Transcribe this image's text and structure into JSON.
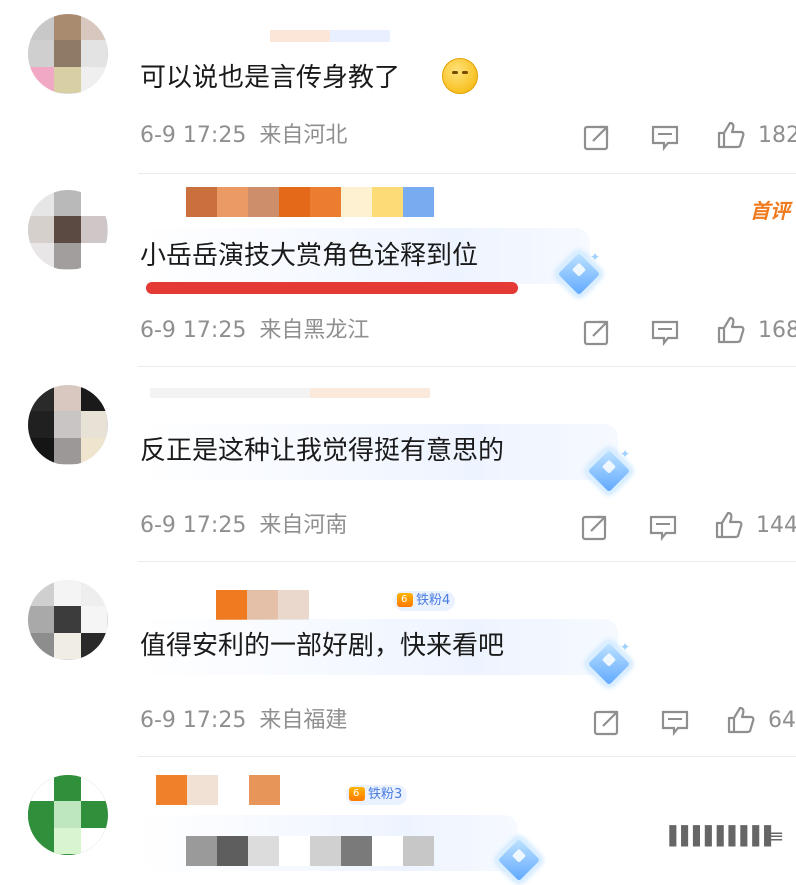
{
  "comments": [
    {
      "text": "可以说也是言传身教了",
      "time": "6-9 17:25",
      "location": "来自河北",
      "likes": "182",
      "emoji": "thinking-face"
    },
    {
      "text": "小岳岳演技大赏角色诠释到位",
      "time": "6-9 17:25",
      "location": "来自黑龙江",
      "likes": "168",
      "tag": "首评"
    },
    {
      "text": "反正是这种让我觉得挺有意思的",
      "time": "6-9 17:25",
      "location": "来自河南",
      "likes": "144"
    },
    {
      "text": "值得安利的一部好剧，快来看吧",
      "time": "6-9 17:25",
      "location": "来自福建",
      "likes": "64",
      "badge": "铁粉4"
    },
    {
      "badge": "铁粉3"
    }
  ],
  "icons": {
    "share": "share-icon",
    "comment": "comment-icon",
    "like": "thumbs-up-icon",
    "gem": "diamond-badge-icon"
  },
  "colors": {
    "meta_text": "#8f8f8f",
    "first_comment_tag": "#f07a1e",
    "badge_text": "#4a7de0",
    "highlight_stroke": "#e53935"
  }
}
